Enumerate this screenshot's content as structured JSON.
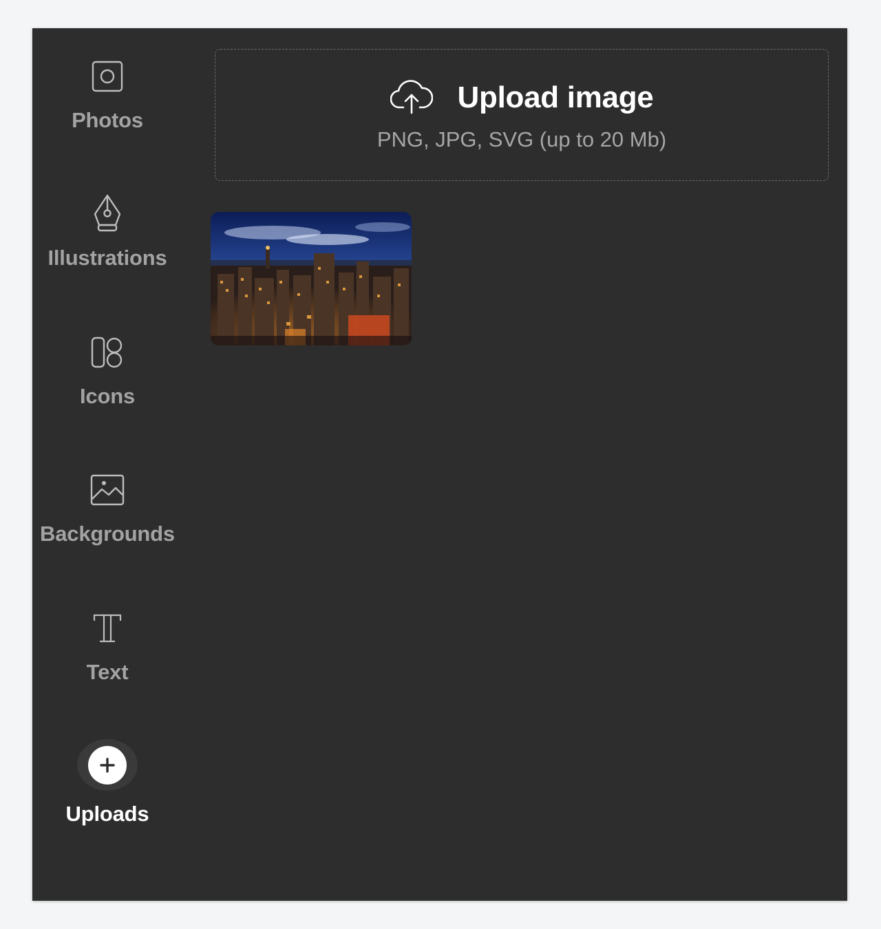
{
  "sidebar": {
    "items": [
      {
        "label": "Photos",
        "icon": "photo-square-icon"
      },
      {
        "label": "Illustrations",
        "icon": "pen-nib-icon"
      },
      {
        "label": "Icons",
        "icon": "shapes-icon"
      },
      {
        "label": "Backgrounds",
        "icon": "landscape-image-icon"
      },
      {
        "label": "Text",
        "icon": "text-t-icon"
      },
      {
        "label": "Uploads",
        "icon": "plus-circle-icon"
      }
    ],
    "active": "Uploads"
  },
  "upload": {
    "title": "Upload image",
    "subtitle": "PNG, JPG, SVG (up to 20 Mb)",
    "icon": "cloud-upload-icon"
  },
  "uploads": [
    {
      "kind": "image",
      "subject": "night city skyline"
    }
  ],
  "colors": {
    "panel": "#2d2d2d",
    "active_label": "#ffffff",
    "inactive_label": "#a3a3a3"
  }
}
